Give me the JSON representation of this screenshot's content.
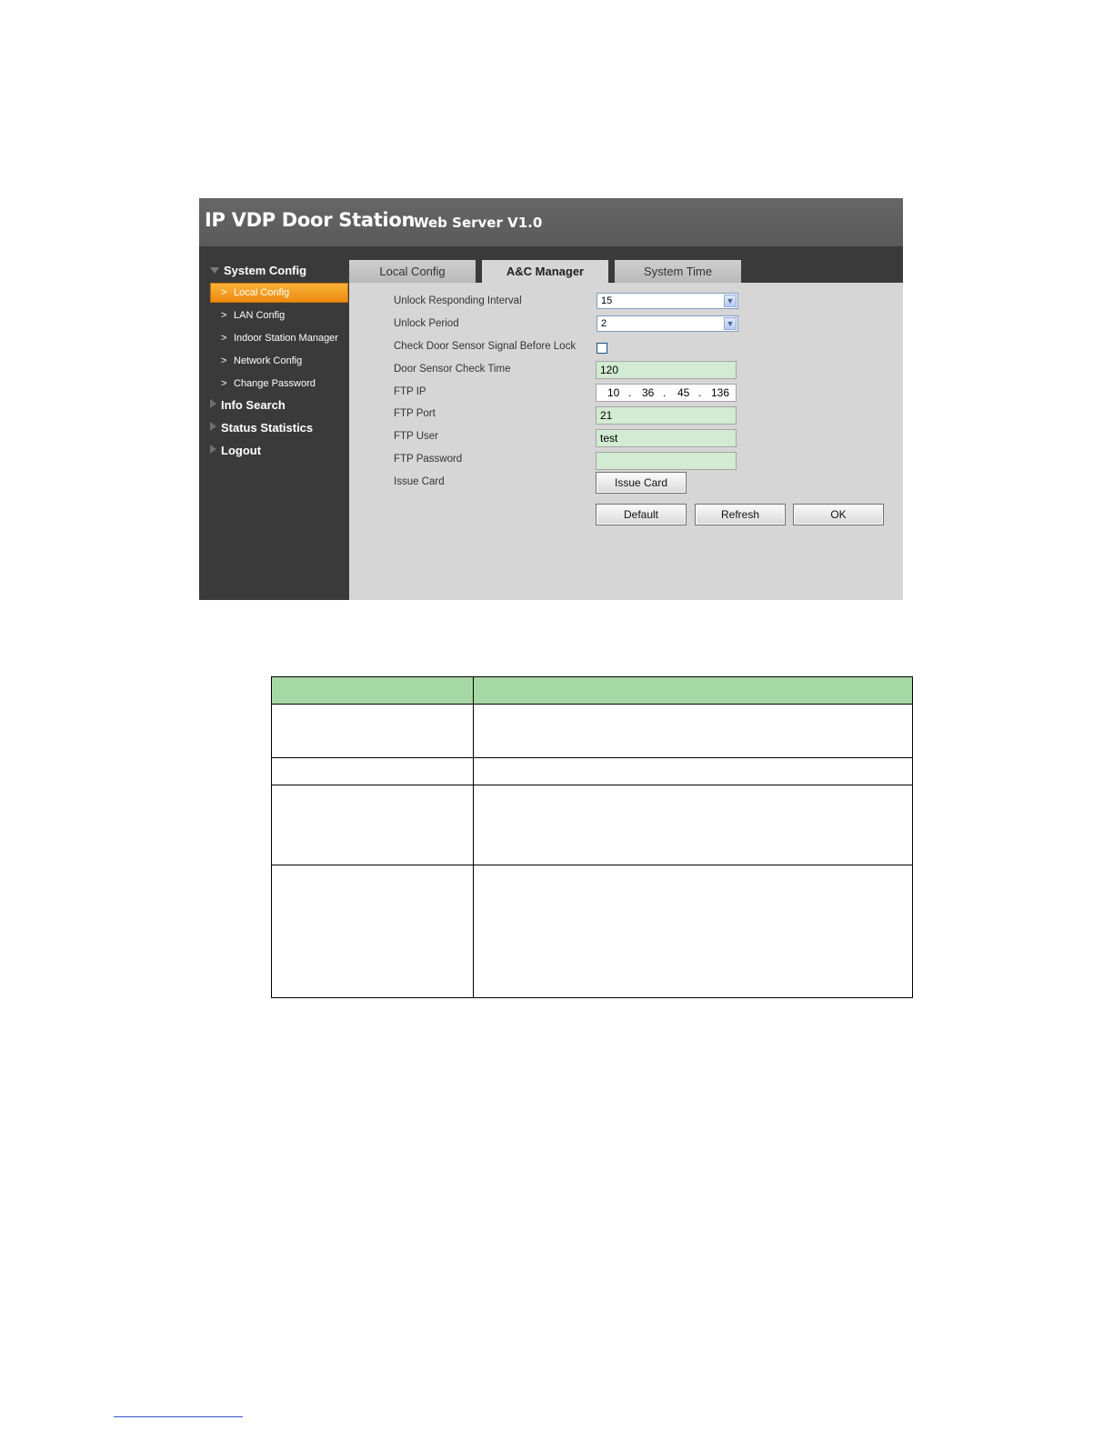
{
  "app": {
    "title": "IP VDP Door Station",
    "subtitle": "Web Server V1.0"
  },
  "sidebar": {
    "sections": [
      {
        "label": "System Config",
        "expanded": true
      },
      {
        "label": "Info Search",
        "expanded": false
      },
      {
        "label": "Status Statistics",
        "expanded": false
      },
      {
        "label": "Logout",
        "expanded": false
      }
    ],
    "system_config_items": [
      {
        "label": "Local Config",
        "active": true
      },
      {
        "label": "LAN Config",
        "active": false
      },
      {
        "label": "Indoor Station Manager",
        "active": false
      },
      {
        "label": "Network Config",
        "active": false
      },
      {
        "label": "Change Password",
        "active": false
      }
    ],
    "chevron": ">"
  },
  "tabs": [
    {
      "label": "Local Config",
      "active": false
    },
    {
      "label": "A&C Manager",
      "active": true
    },
    {
      "label": "System Time",
      "active": false
    }
  ],
  "form": {
    "unlock_interval": {
      "label": "Unlock Responding Interval",
      "value": "15"
    },
    "unlock_period": {
      "label": "Unlock Period",
      "value": "2"
    },
    "check_sensor": {
      "label": "Check Door Sensor Signal Before Lock",
      "checked": false
    },
    "sensor_check_time": {
      "label": "Door Sensor Check Time",
      "value": "120"
    },
    "ftp_ip": {
      "label": "FTP IP",
      "octets": [
        "10",
        "36",
        "45",
        "136"
      ],
      "dot": "."
    },
    "ftp_port": {
      "label": "FTP Port",
      "value": "21"
    },
    "ftp_user": {
      "label": "FTP User",
      "value": "test"
    },
    "ftp_password": {
      "label": "FTP Password",
      "value": ""
    },
    "issue_card": {
      "label": "Issue Card",
      "button": "Issue Card"
    }
  },
  "actions": {
    "default": "Default",
    "refresh": "Refresh",
    "ok": "OK"
  },
  "colors": {
    "header_bg": "#5f5f5f",
    "sidebar_bg": "#3a3a3a",
    "active_item": "#f39c1e",
    "field_bg": "#d2ebd2",
    "table_header": "#a6d8a6"
  }
}
